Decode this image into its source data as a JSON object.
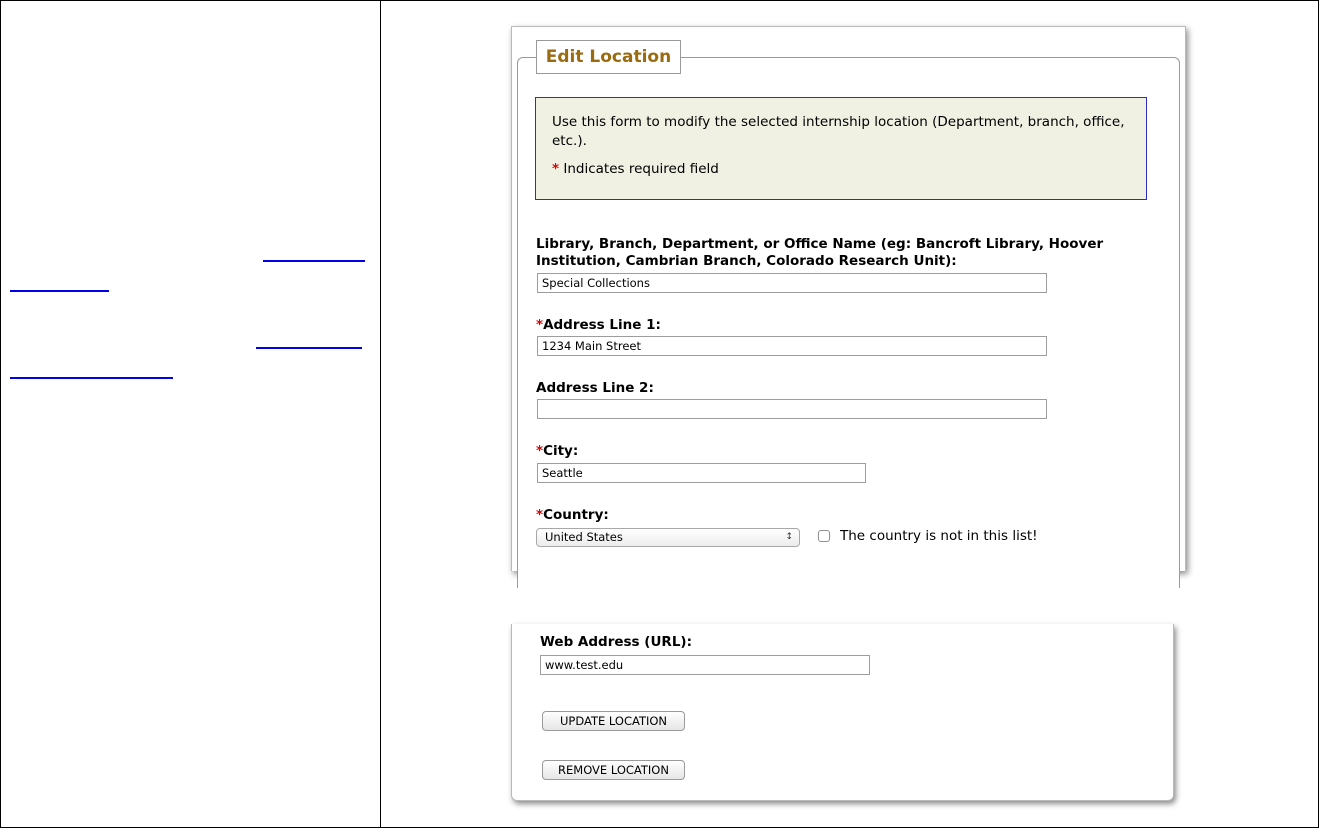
{
  "form": {
    "legend": "Edit Location",
    "intro": "Use this form to modify the selected internship location (Department, branch, office, etc.).",
    "required_marker": "*",
    "required_note": "Indicates required field",
    "fields": {
      "name_label": "Library, Branch, Department, or Office Name (eg: Bancroft Library, Hoover Institution, Cambrian Branch, Colorado Research Unit):",
      "name_value": "Special Collections",
      "address1_label": "Address Line 1:",
      "address1_value": "1234 Main Street",
      "address2_label": "Address Line 2:",
      "address2_value": "",
      "city_label": "City:",
      "city_value": "Seattle",
      "country_label": "Country:",
      "country_selected": "United States",
      "country_missing_label": "The country is not in this list!",
      "url_label": "Web Address (URL):",
      "url_value": "www.test.edu"
    },
    "buttons": {
      "update": "UPDATE LOCATION",
      "remove": "REMOVE LOCATION"
    }
  },
  "icons": {
    "select_arrow": "updown-arrow-icon"
  },
  "colors": {
    "legend_text": "#9a6b10",
    "info_bg": "#f0f1e3",
    "info_border": "#2b2bd0",
    "required": "#e00000",
    "link": "#0000ee"
  }
}
